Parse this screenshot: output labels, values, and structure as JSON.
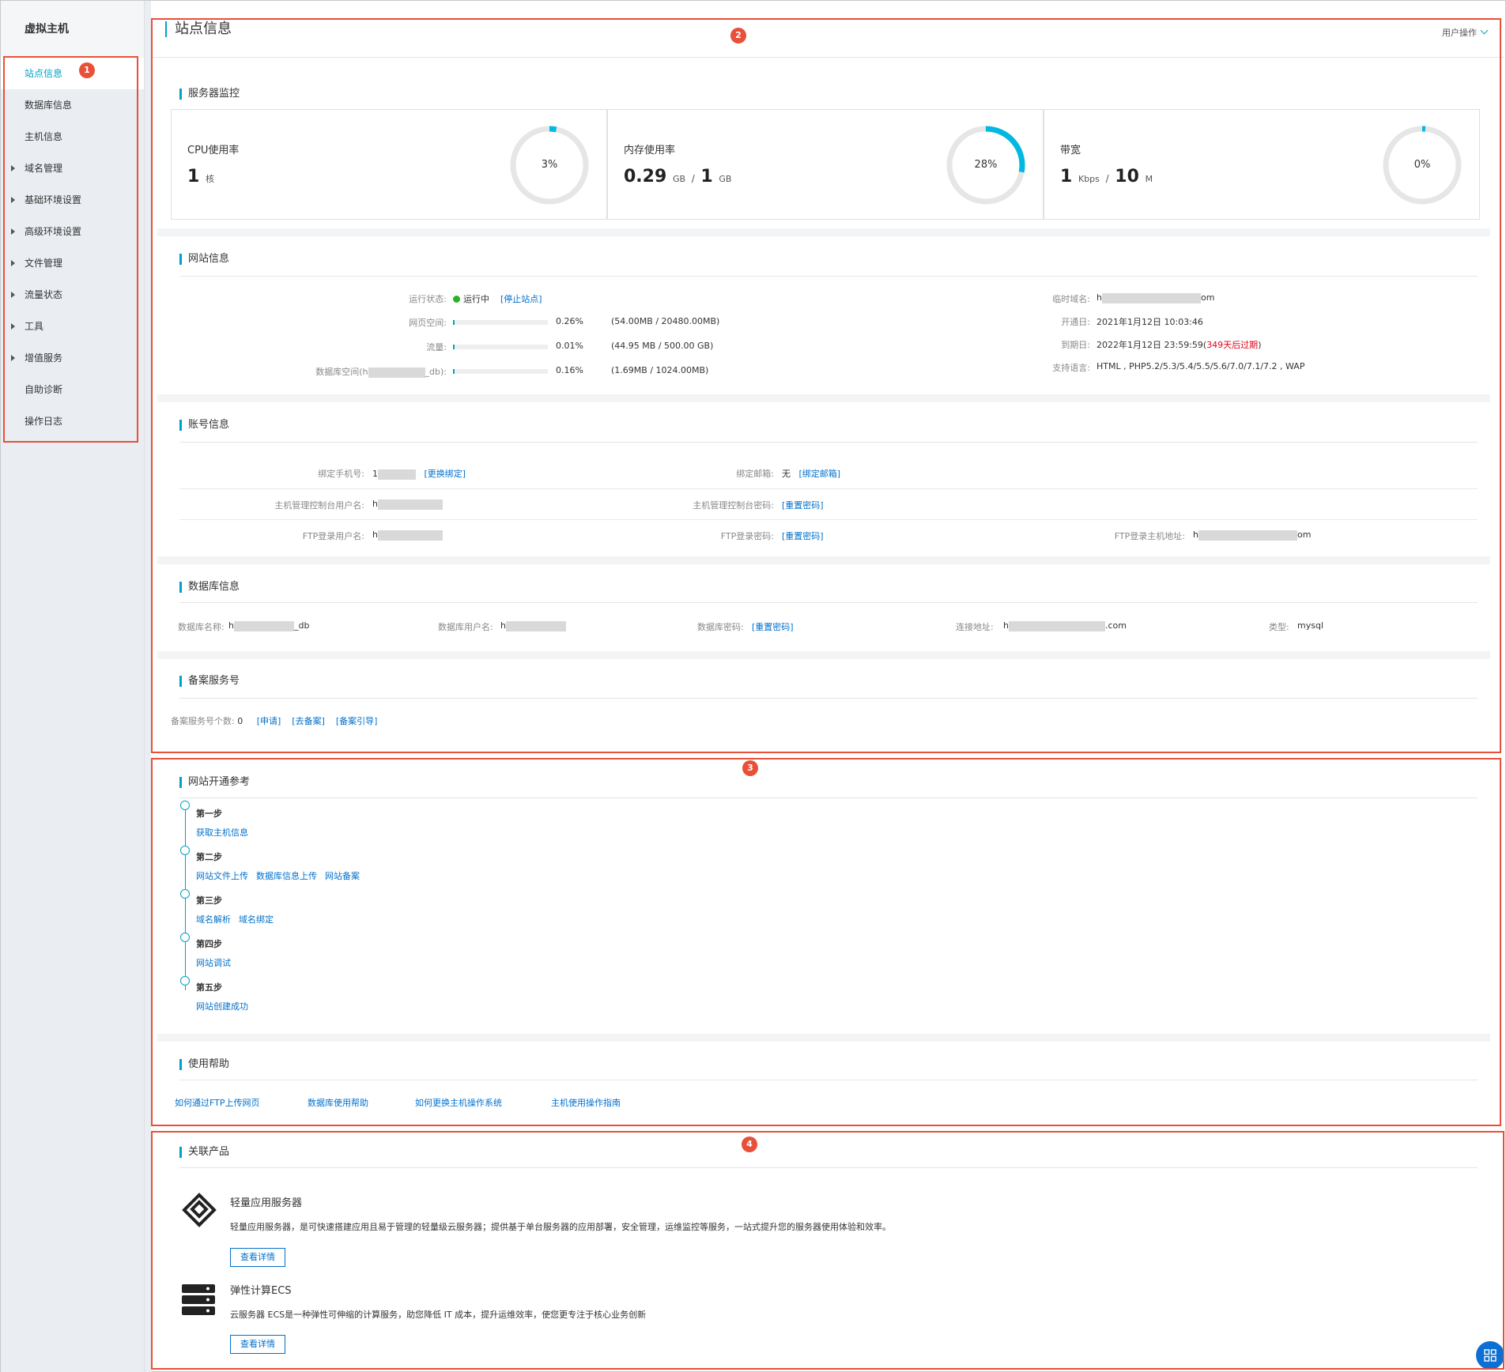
{
  "sidebar": {
    "title": "虚拟主机",
    "items": [
      {
        "label": "站点信息",
        "active": true,
        "caret": false
      },
      {
        "label": "数据库信息",
        "active": false,
        "caret": false
      },
      {
        "label": "主机信息",
        "active": false,
        "caret": false
      },
      {
        "label": "域名管理",
        "active": false,
        "caret": true
      },
      {
        "label": "基础环境设置",
        "active": false,
        "caret": true
      },
      {
        "label": "高级环境设置",
        "active": false,
        "caret": true
      },
      {
        "label": "文件管理",
        "active": false,
        "caret": true
      },
      {
        "label": "流量状态",
        "active": false,
        "caret": true
      },
      {
        "label": "工具",
        "active": false,
        "caret": true
      },
      {
        "label": "增值服务",
        "active": false,
        "caret": true
      },
      {
        "label": "自助诊断",
        "active": false,
        "caret": false
      },
      {
        "label": "操作日志",
        "active": false,
        "caret": false
      }
    ]
  },
  "annotations": [
    "1",
    "2",
    "3",
    "4"
  ],
  "header": {
    "title": "站点信息",
    "user_ops": "用户操作"
  },
  "monitor": {
    "title": "服务器监控",
    "cpu": {
      "label": "CPU使用率",
      "value": "1",
      "unit": "核",
      "percent_text": "3%",
      "percent": 3
    },
    "mem": {
      "label": "内存使用率",
      "used": "0.29",
      "used_unit": "GB",
      "sep": "/",
      "total": "1",
      "total_unit": "GB",
      "percent_text": "28%",
      "percent": 28
    },
    "bw": {
      "label": "带宽",
      "used": "1",
      "used_unit": "Kbps",
      "sep": "/",
      "total": "10",
      "total_unit": "M",
      "percent_text": "0%",
      "percent": 0
    }
  },
  "site": {
    "title": "网站信息",
    "status_label": "运行状态:",
    "status": "运行中",
    "stop_link": "[停止站点]",
    "web_label": "网页空间:",
    "web_pct": "0.26%",
    "web_detail": "(54.00MB / 20480.00MB)",
    "web_fill": 0.26,
    "traffic_label": "流量:",
    "traffic_pct": "0.01%",
    "traffic_detail": "(44.95 MB / 500.00 GB)",
    "traffic_fill": 0.01,
    "db_label_pre": "数据库空间(h",
    "db_label_post": "_db):",
    "db_pct": "0.16%",
    "db_detail": "(1.69MB / 1024.00MB)",
    "db_fill": 0.16,
    "tmp_domain_label": "临时域名:",
    "tmp_domain_pre": "h",
    "tmp_domain_post": "om",
    "open_label": "开通日:",
    "open_date": "2021年1月12日 10:03:46",
    "expire_label": "到期日:",
    "expire_date": "2022年1月12日 23:59:59(",
    "expire_warn": "349天后过期",
    "expire_close": ")",
    "lang_label": "支持语言:",
    "langs": "HTML , PHP5.2/5.3/5.4/5.5/5.6/7.0/7.1/7.2 , WAP"
  },
  "account": {
    "title": "账号信息",
    "phone_label": "绑定手机号:",
    "phone_pre": "1",
    "phone_link": "[更换绑定]",
    "email_label": "绑定邮箱:",
    "email_val": "无",
    "email_link": "[绑定邮箱]",
    "console_user_label": "主机管理控制台用户名:",
    "console_user_pre": "h",
    "console_pwd_label": "主机管理控制台密码:",
    "console_pwd_link": "[重置密码]",
    "ftp_user_label": "FTP登录用户名:",
    "ftp_user_pre": "h",
    "ftp_pwd_label": "FTP登录密码:",
    "ftp_pwd_link": "[重置密码]",
    "ftp_host_label": "FTP登录主机地址:",
    "ftp_host_pre": "h",
    "ftp_host_post": "om"
  },
  "database": {
    "title": "数据库信息",
    "name_label": "数据库名称:",
    "name_pre": "h",
    "name_post": "_db",
    "user_label": "数据库用户名:",
    "user_pre": "h",
    "pwd_label": "数据库密码:",
    "pwd_link": "[重置密码]",
    "host_label": "连接地址:",
    "host_pre": "h",
    "host_post": ".com",
    "type_label": "类型:",
    "type_val": "mysql"
  },
  "beian": {
    "title": "备案服务号",
    "count_label": "备案服务号个数:",
    "count": "0",
    "links": [
      "[申请]",
      "[去备案]",
      "[备案引导]"
    ]
  },
  "steps": {
    "title": "网站开通参考",
    "items": [
      {
        "title": "第一步",
        "links": [
          "获取主机信息"
        ]
      },
      {
        "title": "第二步",
        "links": [
          "网站文件上传",
          "数据库信息上传",
          "网站备案"
        ]
      },
      {
        "title": "第三步",
        "links": [
          "域名解析",
          "域名绑定"
        ]
      },
      {
        "title": "第四步",
        "links": [
          "网站调试"
        ]
      },
      {
        "title": "第五步",
        "links": [
          "网站创建成功"
        ]
      }
    ]
  },
  "help": {
    "title": "使用帮助",
    "links": [
      "如何通过FTP上传网页",
      "数据库使用帮助",
      "如何更换主机操作系统",
      "主机使用操作指南"
    ]
  },
  "products": {
    "title": "关联产品",
    "items": [
      {
        "name": "轻量应用服务器",
        "desc": "轻量应用服务器，是可快速搭建应用且易于管理的轻量级云服务器；提供基于单台服务器的应用部署，安全管理，运维监控等服务，一站式提升您的服务器使用体验和效率。",
        "button": "查看详情",
        "icon": "lightweight-server-icon"
      },
      {
        "name": "弹性计算ECS",
        "desc": "云服务器 ECS是一种弹性可伸缩的计算服务，助您降低 IT 成本，提升运维效率，使您更专注于核心业务创新",
        "button": "查看详情",
        "icon": "ecs-server-icon"
      }
    ]
  },
  "colors": {
    "accent": "#00a2ca",
    "link": "#0070cc",
    "annotation": "#e8503a",
    "status_ok": "#29b329",
    "warn": "#e0001a"
  }
}
